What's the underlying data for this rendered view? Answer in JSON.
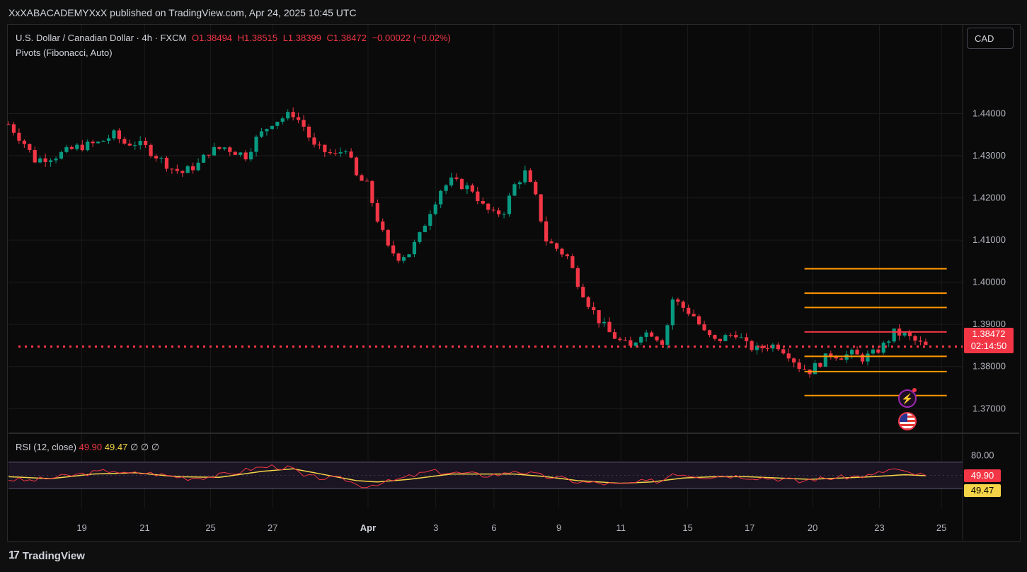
{
  "header": {
    "text": "XxXABACADEMYXxX published on TradingView.com, Apr 24, 2025 10:45 UTC"
  },
  "legend": {
    "symbol": "U.S. Dollar / Canadian Dollar · 4h · FXCM",
    "open": "O1.38494",
    "high": "H1.38515",
    "low": "L1.38399",
    "close": "C1.38472",
    "change": "−0.00022 (−0.02%)",
    "pivots": "Pivots (Fibonacci, Auto)"
  },
  "currency_button": "CAD",
  "rsi_legend": {
    "label": "RSI (12, close)",
    "rsi": "49.90",
    "ma": "49.47",
    "extra": "∅ ∅ ∅"
  },
  "price_tag": {
    "price": "1.38472",
    "countdown": "02:14:50"
  },
  "rsi_tags": {
    "rsi": "49.90",
    "ma": "49.47"
  },
  "footer": {
    "brand": "TradingView",
    "logo": "17"
  },
  "icons": {
    "bolt": "lightning-icon",
    "flag": "us-flag-icon"
  },
  "colors": {
    "up": "#089981",
    "down": "#f23645",
    "pivot": "#ff9800",
    "rsi": "#f23645",
    "rsi_ma": "#f5d547",
    "current": "#f23645"
  },
  "chart_data": {
    "type": "candlestick",
    "y_ticks": [
      "1.44000",
      "1.43000",
      "1.42000",
      "1.41000",
      "1.40000",
      "1.39000",
      "1.38000",
      "1.37000"
    ],
    "y_range": [
      1.3645,
      1.451
    ],
    "x_ticks": [
      "19",
      "21",
      "25",
      "27",
      "Apr",
      "3",
      "6",
      "9",
      "11",
      "15",
      "17",
      "20",
      "23",
      "25"
    ],
    "close_path": [
      [
        0,
        1.4375
      ],
      [
        3,
        1.433
      ],
      [
        5,
        1.429
      ],
      [
        9,
        1.43
      ],
      [
        13,
        1.432
      ],
      [
        17,
        1.433
      ],
      [
        20,
        1.435
      ],
      [
        22,
        1.433
      ],
      [
        24,
        1.433
      ],
      [
        26,
        1.432
      ],
      [
        29,
        1.429
      ],
      [
        31,
        1.427
      ],
      [
        33,
        1.426
      ],
      [
        36,
        1.428
      ],
      [
        38,
        1.431
      ],
      [
        41,
        1.432
      ],
      [
        43,
        1.431
      ],
      [
        45,
        1.43
      ],
      [
        47,
        1.434
      ],
      [
        50,
        1.438
      ],
      [
        53,
        1.4395
      ],
      [
        54,
        1.44
      ],
      [
        56,
        1.437
      ],
      [
        58,
        1.432
      ],
      [
        60,
        1.431
      ],
      [
        62,
        1.43
      ],
      [
        64,
        1.432
      ],
      [
        66,
        1.425
      ],
      [
        68,
        1.423
      ],
      [
        70,
        1.415
      ],
      [
        72,
        1.408
      ],
      [
        74,
        1.406
      ],
      [
        76,
        1.407
      ],
      [
        78,
        1.411
      ],
      [
        80,
        1.417
      ],
      [
        82,
        1.422
      ],
      [
        84,
        1.424
      ],
      [
        86,
        1.423
      ],
      [
        88,
        1.422
      ],
      [
        90,
        1.418
      ],
      [
        92,
        1.416
      ],
      [
        94,
        1.417
      ],
      [
        96,
        1.423
      ],
      [
        98,
        1.426
      ],
      [
        100,
        1.42
      ],
      [
        102,
        1.41
      ],
      [
        104,
        1.408
      ],
      [
        106,
        1.406
      ],
      [
        108,
        1.4
      ],
      [
        110,
        1.395
      ],
      [
        112,
        1.391
      ],
      [
        114,
        1.388
      ],
      [
        116,
        1.386
      ],
      [
        118,
        1.3845
      ],
      [
        120,
        1.388
      ],
      [
        122,
        1.388
      ],
      [
        124,
        1.386
      ],
      [
        125,
        1.39
      ],
      [
        126,
        1.396
      ],
      [
        128,
        1.394
      ],
      [
        130,
        1.392
      ],
      [
        132,
        1.388
      ],
      [
        134,
        1.386
      ],
      [
        136,
        1.387
      ],
      [
        138,
        1.388
      ],
      [
        140,
        1.385
      ],
      [
        142,
        1.384
      ],
      [
        144,
        1.385
      ],
      [
        146,
        1.385
      ],
      [
        148,
        1.383
      ],
      [
        150,
        1.38
      ],
      [
        152,
        1.379
      ],
      [
        154,
        1.381
      ],
      [
        156,
        1.383
      ],
      [
        158,
        1.3825
      ],
      [
        160,
        1.383
      ],
      [
        162,
        1.382
      ],
      [
        164,
        1.383
      ],
      [
        166,
        1.385
      ],
      [
        168,
        1.388
      ],
      [
        170,
        1.3875
      ],
      [
        172,
        1.386
      ],
      [
        174,
        1.3847
      ]
    ],
    "x_index_range": [
      0,
      181
    ],
    "current_price": 1.38472,
    "pivot_levels": [
      1.4032,
      1.3974,
      1.394,
      1.3882,
      1.3824,
      1.3788,
      1.3731
    ],
    "pivot_labels": [],
    "rsi": {
      "y_ticks": [
        "80.00"
      ],
      "range": [
        0,
        100
      ],
      "bands": [
        30,
        70
      ],
      "rsi_path": [
        [
          0,
          44
        ],
        [
          4,
          42
        ],
        [
          8,
          46
        ],
        [
          12,
          50
        ],
        [
          16,
          54
        ],
        [
          20,
          58
        ],
        [
          22,
          52
        ],
        [
          26,
          54
        ],
        [
          30,
          50
        ],
        [
          34,
          46
        ],
        [
          38,
          48
        ],
        [
          42,
          52
        ],
        [
          46,
          60
        ],
        [
          50,
          64
        ],
        [
          54,
          60
        ],
        [
          56,
          48
        ],
        [
          60,
          46
        ],
        [
          64,
          44
        ],
        [
          66,
          36
        ],
        [
          68,
          34
        ],
        [
          70,
          38
        ],
        [
          72,
          40
        ],
        [
          76,
          48
        ],
        [
          80,
          56
        ],
        [
          84,
          54
        ],
        [
          88,
          52
        ],
        [
          90,
          50
        ],
        [
          94,
          52
        ],
        [
          96,
          58
        ],
        [
          98,
          54
        ],
        [
          102,
          48
        ],
        [
          106,
          44
        ],
        [
          108,
          40
        ],
        [
          112,
          38
        ],
        [
          116,
          36
        ],
        [
          120,
          40
        ],
        [
          124,
          42
        ],
        [
          126,
          54
        ],
        [
          128,
          52
        ],
        [
          132,
          48
        ],
        [
          136,
          50
        ],
        [
          140,
          48
        ],
        [
          144,
          46
        ],
        [
          148,
          44
        ],
        [
          150,
          40
        ],
        [
          152,
          44
        ],
        [
          156,
          46
        ],
        [
          160,
          48
        ],
        [
          164,
          50
        ],
        [
          166,
          56
        ],
        [
          168,
          60
        ],
        [
          170,
          54
        ],
        [
          172,
          52
        ],
        [
          174,
          49.9
        ]
      ],
      "ma_path": [
        [
          0,
          48
        ],
        [
          8,
          45
        ],
        [
          16,
          52
        ],
        [
          24,
          54
        ],
        [
          32,
          48
        ],
        [
          40,
          47
        ],
        [
          48,
          56
        ],
        [
          54,
          60
        ],
        [
          58,
          54
        ],
        [
          62,
          48
        ],
        [
          66,
          42
        ],
        [
          70,
          40
        ],
        [
          76,
          44
        ],
        [
          84,
          52
        ],
        [
          90,
          52
        ],
        [
          96,
          52
        ],
        [
          102,
          48
        ],
        [
          108,
          42
        ],
        [
          116,
          38
        ],
        [
          122,
          40
        ],
        [
          128,
          46
        ],
        [
          134,
          48
        ],
        [
          140,
          48
        ],
        [
          146,
          46
        ],
        [
          152,
          44
        ],
        [
          158,
          46
        ],
        [
          164,
          48
        ],
        [
          170,
          51
        ],
        [
          174,
          49.47
        ]
      ],
      "rsi_value": 49.9,
      "ma_value": 49.47
    }
  }
}
